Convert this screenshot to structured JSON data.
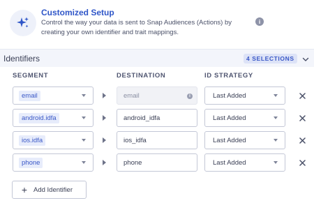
{
  "header": {
    "title": "Customized Setup",
    "description": "Control the way your data is sent to Snap Audiences (Actions) by creating your own identifier and trait mappings.",
    "icon": "sparkle-icon",
    "info_icon": "info-icon"
  },
  "identifiers": {
    "title": "Identifiers",
    "selections": "4 SELECTIONS",
    "columns": {
      "segment": "SEGMENT",
      "destination": "DESTINATION",
      "id_strategy": "ID STRATEGY"
    },
    "rows": [
      {
        "segment": "email",
        "destination": "email",
        "destination_disabled": true,
        "id_strategy": "Last Added"
      },
      {
        "segment": "android.idfa",
        "destination": "android_idfa",
        "destination_disabled": false,
        "id_strategy": "Last Added"
      },
      {
        "segment": "ios.idfa",
        "destination": "ios_idfa",
        "destination_disabled": false,
        "id_strategy": "Last Added"
      },
      {
        "segment": "phone",
        "destination": "phone",
        "destination_disabled": false,
        "id_strategy": "Last Added"
      }
    ],
    "add_label": "Add Identifier"
  },
  "colors": {
    "accent": "#2f56c8",
    "chip_bg": "#e7ecfb",
    "section_bg": "#f3f5fb"
  }
}
